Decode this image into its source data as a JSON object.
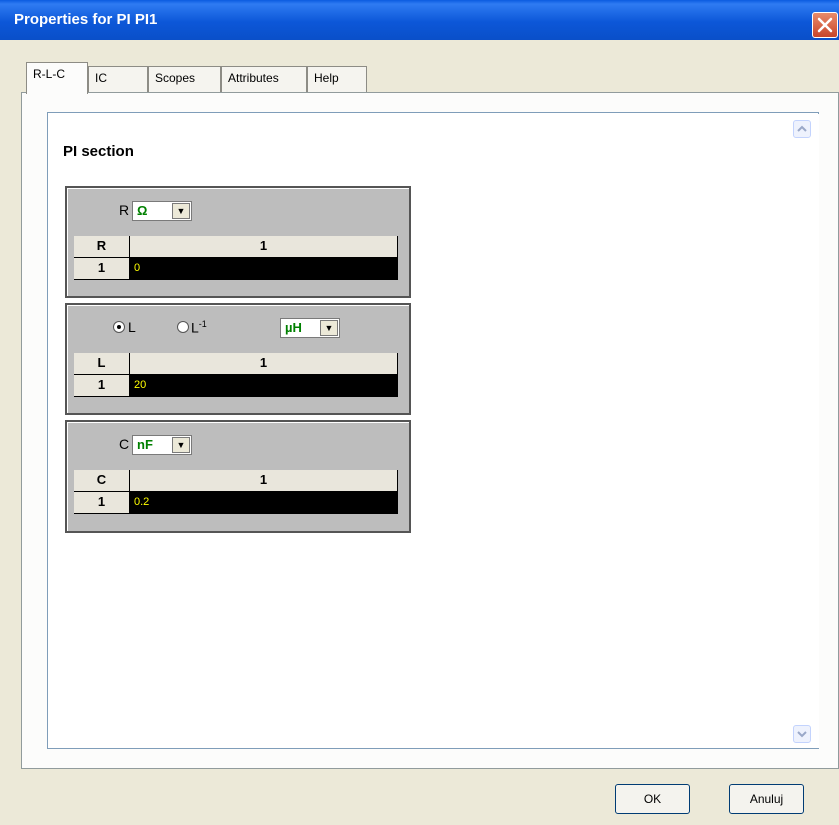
{
  "window": {
    "title": "Properties for PI PI1",
    "close_icon": "close-icon"
  },
  "tabs": [
    {
      "label": "R-L-C",
      "active": true
    },
    {
      "label": "IC",
      "active": false
    },
    {
      "label": "Scopes",
      "active": false
    },
    {
      "label": "Attributes",
      "active": false
    },
    {
      "label": "Help",
      "active": false
    }
  ],
  "section": {
    "title": "PI section"
  },
  "groups": {
    "R": {
      "label": "R",
      "unit": "Ω",
      "grid_corner": "R",
      "grid_column": "1",
      "grid_row": "1",
      "value": "0"
    },
    "L": {
      "radio_l_label": "L",
      "radio_linv_label": "L",
      "radio_linv_sup": "-1",
      "selected": "L",
      "unit": "µH",
      "grid_corner": "L",
      "grid_column": "1",
      "grid_row": "1",
      "value": "20"
    },
    "C": {
      "label": "C",
      "unit": "nF",
      "grid_corner": "C",
      "grid_column": "1",
      "grid_row": "1",
      "value": "0.2"
    }
  },
  "buttons": {
    "ok": "OK",
    "cancel": "Anuluj"
  },
  "colors": {
    "title_bar": "#0a5be0",
    "value_text": "#ffff00",
    "unit_text": "#008000"
  }
}
